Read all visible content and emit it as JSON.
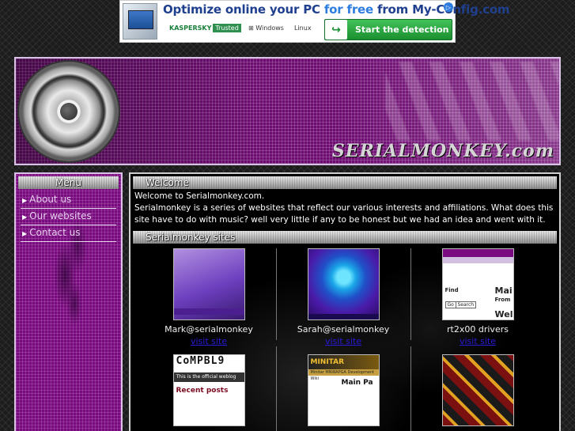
{
  "ad": {
    "title_pre": "Optimize online your PC ",
    "title_blue": "for free",
    "title_post": " from My-Config.com",
    "brand_kaspersky": "KASPERSKY",
    "brand_trusted": "Trusted",
    "brand_windows": "Windows",
    "brand_linux": "Linux",
    "cta": "Start the detection",
    "cta_icon": "arrow-icon",
    "corner_icon": "ad-choices-icon"
  },
  "header": {
    "logo_text": "SERIALMONKEY.com"
  },
  "menu": {
    "title": "Menu",
    "items": [
      {
        "label": "About us"
      },
      {
        "label": "Our websites"
      },
      {
        "label": "Contact us"
      }
    ]
  },
  "main": {
    "welcome_title": "Welcome",
    "intro_line1": "Welcome to Serialmonkey.com.",
    "intro_line2": "Serialmonkey is a series of websites that reflect our various interests and affiliations. What does this site have to do with music? well very little if any to be honest but we had an idea and went with it.",
    "sites_title": "Serialmonkey sites",
    "visit_label": "visit site",
    "sites": [
      {
        "name": "Mark@serialmonkey"
      },
      {
        "name": "Sarah@serialmonkey"
      },
      {
        "name": "rt2x00 drivers"
      }
    ],
    "thumbs": {
      "rt_find": "Find",
      "rt_main": "Mai",
      "rt_from": "From",
      "rt_wel": "Wel",
      "rt_go": "Go",
      "rt_search": "Search",
      "cm_logo": "CoMPBL9",
      "cm_sub": "This is the official weblog",
      "cm_recent": "Recent posts",
      "mini_logo": "MINITAR",
      "mini_sub": "Minitar MNWAPGA Development Wiki",
      "mini_main": "Main Pa"
    }
  }
}
